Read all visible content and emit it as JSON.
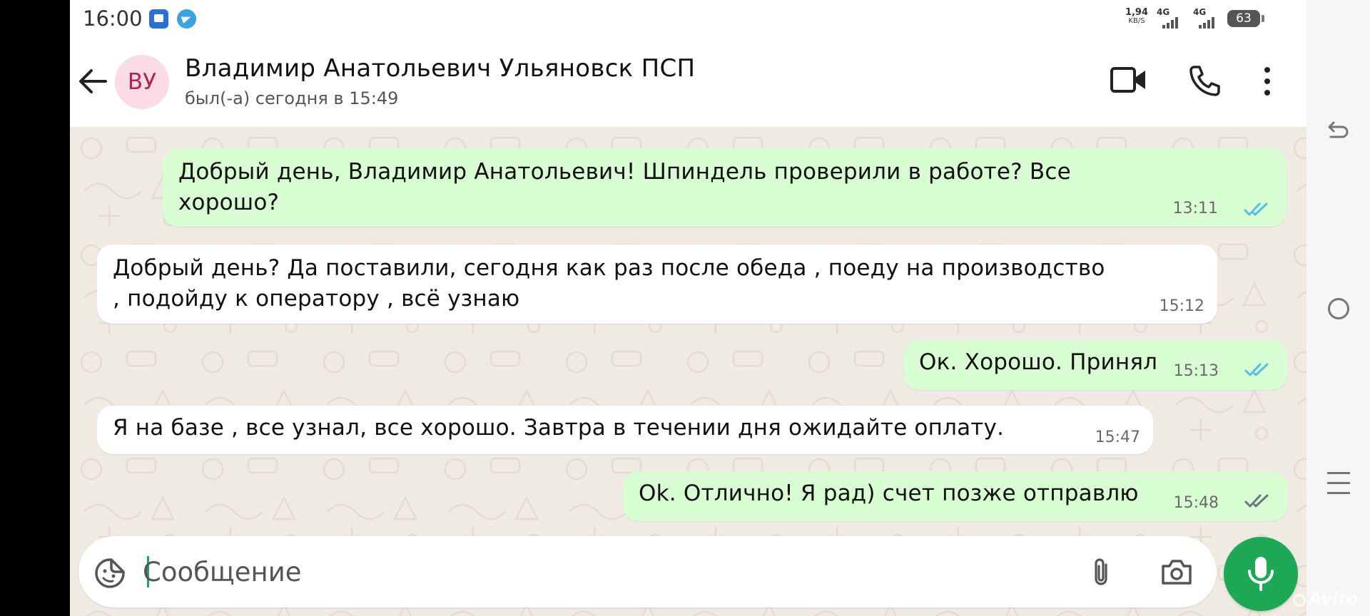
{
  "status_bar": {
    "time": "16:00",
    "net_speed_value": "1,94",
    "net_speed_unit": "KB/S",
    "signal_1_label": "4G",
    "signal_2_label": "4G",
    "battery": "63",
    "notification_icons": [
      "app-icon",
      "telegram-icon"
    ]
  },
  "header": {
    "avatar_initials": "ВУ",
    "contact_name": "Владимир Анатольевич Ульяновск ПСП",
    "last_seen": "был(-а) сегодня в 15:49",
    "icons": [
      "back-arrow-icon",
      "video-call-icon",
      "phone-icon",
      "more-vertical-icon"
    ]
  },
  "messages": [
    {
      "direction": "out",
      "text": "Добрый день, Владимир Анатольевич! Шпиндель проверили в работе? Все хорошо?",
      "time": "13:11",
      "status": "read",
      "tick_color": "#53bdeb"
    },
    {
      "direction": "in",
      "text": "Добрый день? Да поставили, сегодня как раз после обеда , поеду на производство , подойду к оператору , всё узнаю",
      "time": "15:12"
    },
    {
      "direction": "out",
      "text": "Ок. Хорошо. Принял",
      "time": "15:13",
      "status": "read",
      "tick_color": "#53bdeb"
    },
    {
      "direction": "in",
      "text": "Я на базе , все узнал, все хорошо. Завтра в течении дня ожидайте оплату.",
      "time": "15:47"
    },
    {
      "direction": "out",
      "text": "Ok. Отлично! Я рад) счет позже отправлю",
      "time": "15:48",
      "status": "delivered",
      "tick_color": "#667781"
    }
  ],
  "input": {
    "placeholder": "Сообщение",
    "value": "",
    "icons": [
      "sticker-icon",
      "attach-icon",
      "camera-icon",
      "mic-icon"
    ]
  },
  "nav_bar": {
    "icons": [
      "nav-back-icon",
      "nav-home-icon",
      "nav-recent-icon"
    ]
  },
  "watermark": "Avito",
  "colors": {
    "accent": "#1da855",
    "outgoing_bubble": "#d9fdd3",
    "incoming_bubble": "#ffffff",
    "chat_background": "#efeae2",
    "avatar_bg": "#fadbe6",
    "avatar_text": "#b0244e"
  }
}
